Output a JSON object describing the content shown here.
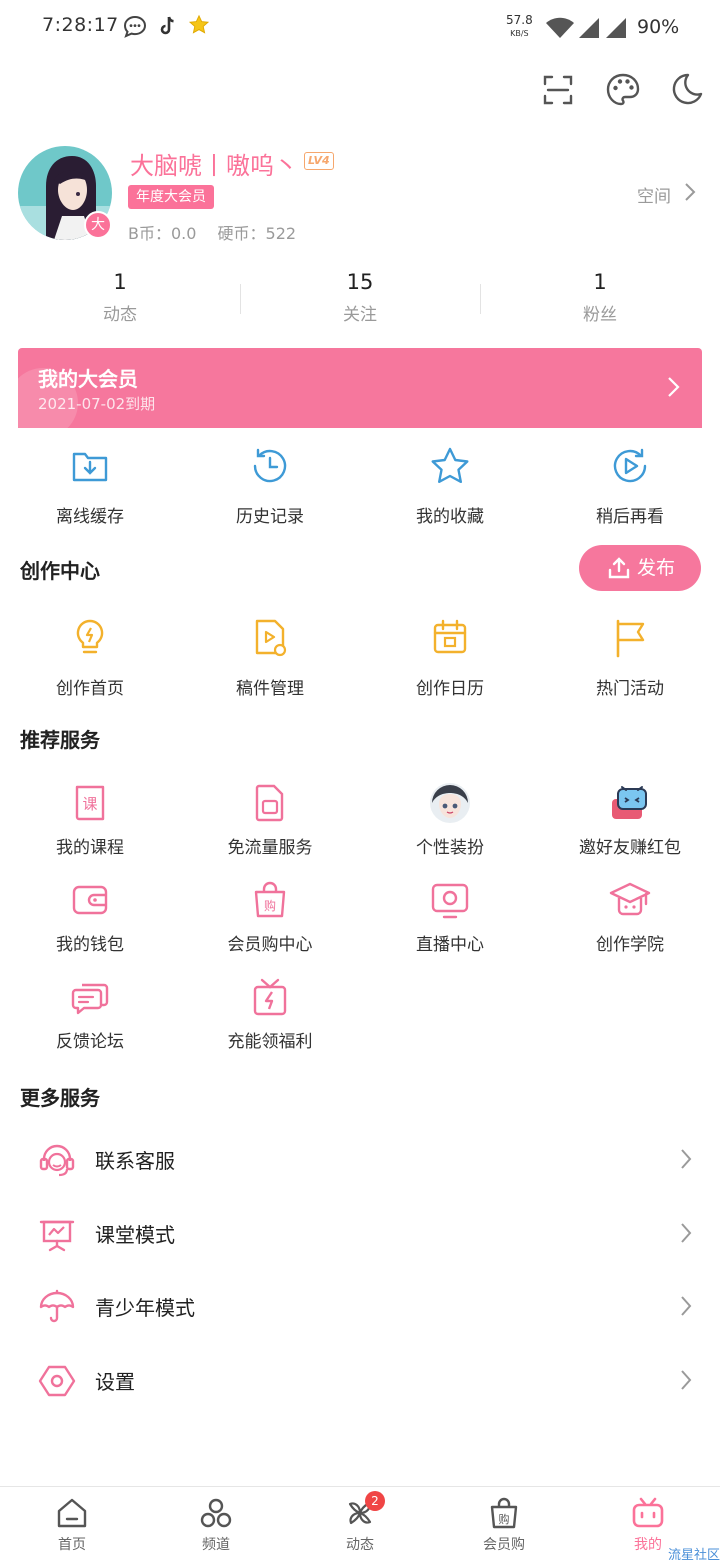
{
  "status_bar": {
    "time": "7:28:17",
    "net_speed": "57.8",
    "net_unit": "KB/S",
    "battery": "90%"
  },
  "profile": {
    "username": "大脑唬丨嗷呜丶",
    "level": "LV4",
    "vip_tag": "年度大会员",
    "avatar_badge": "大",
    "b_coin": "B币：0.0",
    "coin": "硬币：522",
    "space_link": "空间"
  },
  "stats": [
    {
      "num": "1",
      "label": "动态"
    },
    {
      "num": "15",
      "label": "关注"
    },
    {
      "num": "1",
      "label": "粉丝"
    }
  ],
  "vip_banner": {
    "title": "我的大会员",
    "expiry": "2021-07-02到期"
  },
  "quick_actions": [
    {
      "label": "离线缓存",
      "icon": "download-folder-icon"
    },
    {
      "label": "历史记录",
      "icon": "history-clock-icon"
    },
    {
      "label": "我的收藏",
      "icon": "star-icon"
    },
    {
      "label": "稍后再看",
      "icon": "play-later-icon"
    }
  ],
  "creation": {
    "title": "创作中心",
    "publish_label": "发布",
    "items": [
      {
        "label": "创作首页",
        "icon": "lightbulb-icon"
      },
      {
        "label": "稿件管理",
        "icon": "video-file-icon"
      },
      {
        "label": "创作日历",
        "icon": "calendar-icon"
      },
      {
        "label": "热门活动",
        "icon": "flag-icon"
      }
    ]
  },
  "recommend": {
    "title": "推荐服务",
    "items": [
      {
        "label": "我的课程",
        "icon": "course-book-icon"
      },
      {
        "label": "免流量服务",
        "icon": "sim-card-icon"
      },
      {
        "label": "个性装扮",
        "icon": "anime-avatar-icon"
      },
      {
        "label": "邀好友赚红包",
        "icon": "tv-mascot-icon"
      },
      {
        "label": "我的钱包",
        "icon": "wallet-icon"
      },
      {
        "label": "会员购中心",
        "icon": "shopping-bag-icon"
      },
      {
        "label": "直播中心",
        "icon": "live-tv-icon"
      },
      {
        "label": "创作学院",
        "icon": "graduation-cap-icon"
      },
      {
        "label": "反馈论坛",
        "icon": "chat-bubble-icon"
      },
      {
        "label": "充能领福利",
        "icon": "gift-bolt-icon"
      }
    ]
  },
  "more": {
    "title": "更多服务",
    "items": [
      {
        "label": "联系客服",
        "icon": "headset-icon"
      },
      {
        "label": "课堂模式",
        "icon": "presentation-board-icon"
      },
      {
        "label": "青少年模式",
        "icon": "umbrella-icon"
      },
      {
        "label": "设置",
        "icon": "settings-hexagon-icon"
      }
    ]
  },
  "bottom_nav": [
    {
      "label": "首页",
      "icon": "home-icon"
    },
    {
      "label": "频道",
      "icon": "channels-icon"
    },
    {
      "label": "动态",
      "icon": "pinwheel-icon",
      "badge": "2"
    },
    {
      "label": "会员购",
      "icon": "shop-bag-icon"
    },
    {
      "label": "我的",
      "icon": "tv-icon",
      "active": true
    }
  ],
  "watermark": "流星社区",
  "colors": {
    "pink": "#fb7299",
    "banner_pink": "#f6779d",
    "blue": "#3e9ad6",
    "yellow": "#f3b12c"
  }
}
